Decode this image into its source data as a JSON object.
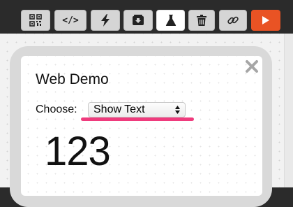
{
  "toolbar": {
    "buttons": [
      {
        "icon": "qr-code-icon"
      },
      {
        "icon": "code-icon",
        "label": "</>"
      },
      {
        "icon": "lightning-icon"
      },
      {
        "icon": "download-box-icon"
      },
      {
        "icon": "flask-icon",
        "active": true
      },
      {
        "icon": "trash-icon"
      },
      {
        "icon": "link-icon"
      },
      {
        "icon": "play-icon",
        "accent": "#e95324"
      }
    ]
  },
  "app": {
    "title": "Web Demo",
    "choose_label": "Choose:",
    "select_value": "Show Text",
    "display_text": "123"
  },
  "colors": {
    "underline": "#ef3b7d",
    "run_button": "#e95324"
  }
}
